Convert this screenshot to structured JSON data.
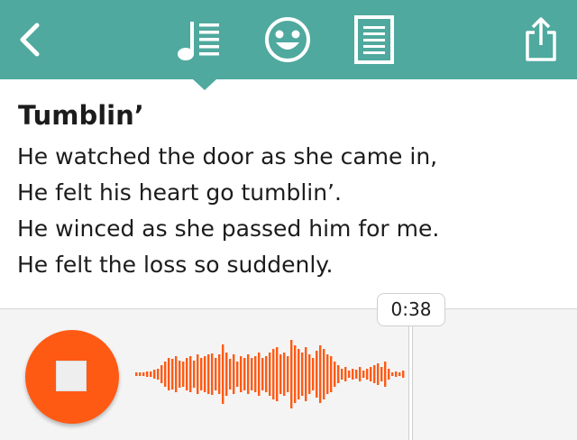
{
  "header": {
    "back_icon": "chevron-left-icon",
    "tabs": [
      {
        "icon": "music-lyrics-icon",
        "selected": true
      },
      {
        "icon": "smiley-face-icon",
        "selected": false
      },
      {
        "icon": "document-icon",
        "selected": false
      }
    ],
    "share_icon": "share-icon",
    "color": "#4fa99e"
  },
  "song": {
    "title": "Tumblin’",
    "lines": [
      "He watched the door as she came in,",
      "He felt his heart go tumblin’.",
      "He winced as she passed him for me.",
      "He felt the loss so suddenly."
    ]
  },
  "recorder": {
    "stop_icon": "stop-icon",
    "time": "0:38",
    "accent_color": "#ff5a14",
    "waveform": [
      2,
      2,
      2,
      3,
      3,
      5,
      6,
      10,
      14,
      18,
      17,
      20,
      15,
      14,
      18,
      20,
      15,
      22,
      18,
      20,
      22,
      23,
      18,
      22,
      33,
      24,
      17,
      22,
      14,
      20,
      18,
      22,
      18,
      20,
      24,
      18,
      20,
      24,
      28,
      30,
      22,
      24,
      20,
      38,
      32,
      28,
      24,
      30,
      22,
      18,
      26,
      32,
      28,
      22,
      20,
      14,
      10,
      6,
      8,
      4,
      6,
      5,
      8,
      4,
      6,
      8,
      10,
      12,
      8,
      14,
      6,
      2,
      3,
      2,
      4
    ]
  }
}
